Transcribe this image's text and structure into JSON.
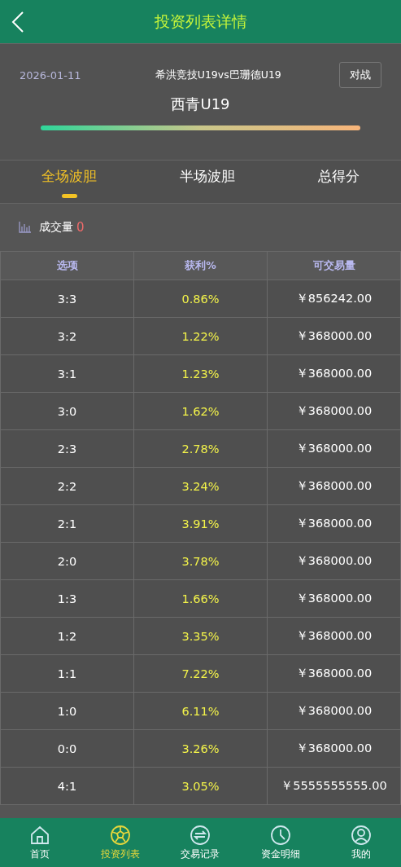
{
  "header": {
    "title": "投资列表详情"
  },
  "match": {
    "date": "2026-01-11",
    "teams": "希洪竞技U19vs巴珊德U19",
    "button": "对战",
    "pick": "西青U19"
  },
  "tabs": [
    {
      "label": "全场波胆",
      "selected": true
    },
    {
      "label": "半场波胆",
      "selected": false
    },
    {
      "label": "总得分",
      "selected": false
    }
  ],
  "volume": {
    "label": "成交量",
    "value": "0"
  },
  "table": {
    "columns": [
      "选项",
      "获利%",
      "可交易量"
    ],
    "rows": [
      [
        "3:3",
        "0.86%",
        "￥856242.00"
      ],
      [
        "3:2",
        "1.22%",
        "￥368000.00"
      ],
      [
        "3:1",
        "1.23%",
        "￥368000.00"
      ],
      [
        "3:0",
        "1.62%",
        "￥368000.00"
      ],
      [
        "2:3",
        "2.78%",
        "￥368000.00"
      ],
      [
        "2:2",
        "3.24%",
        "￥368000.00"
      ],
      [
        "2:1",
        "3.91%",
        "￥368000.00"
      ],
      [
        "2:0",
        "3.78%",
        "￥368000.00"
      ],
      [
        "1:3",
        "1.66%",
        "￥368000.00"
      ],
      [
        "1:2",
        "3.35%",
        "￥368000.00"
      ],
      [
        "1:1",
        "7.22%",
        "￥368000.00"
      ],
      [
        "1:0",
        "6.11%",
        "￥368000.00"
      ],
      [
        "0:0",
        "3.26%",
        "￥368000.00"
      ],
      [
        "4:1",
        "3.05%",
        "￥5555555555.00"
      ]
    ]
  },
  "nav": [
    {
      "label": "首页",
      "selected": false
    },
    {
      "label": "投资列表",
      "selected": true
    },
    {
      "label": "交易记录",
      "selected": false
    },
    {
      "label": "资金明细",
      "selected": false
    },
    {
      "label": "我的",
      "selected": false
    }
  ]
}
